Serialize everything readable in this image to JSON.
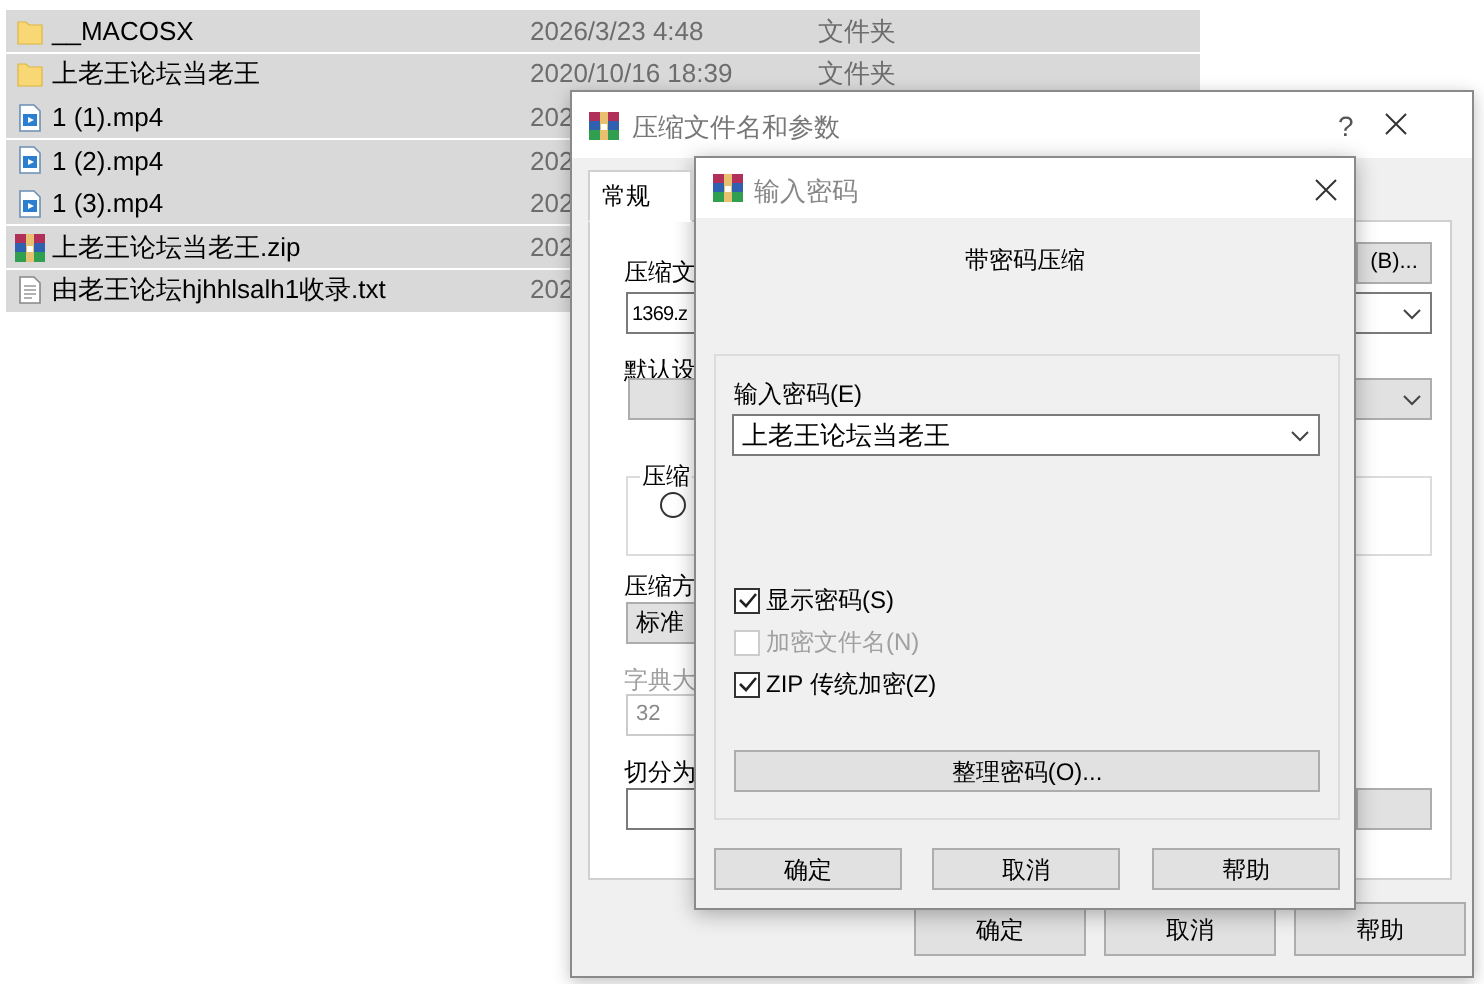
{
  "files": [
    {
      "name": "__MACOSX",
      "date": "2026/3/23 4:48",
      "type": "文件夹",
      "kind": "folder"
    },
    {
      "name": "上老王论坛当老王",
      "date": "2020/10/16 18:39",
      "type": "文件夹",
      "kind": "folder"
    },
    {
      "name": "1 (1).mp4",
      "date": "202",
      "kind": "video"
    },
    {
      "name": "1 (2).mp4",
      "date": "202",
      "kind": "video"
    },
    {
      "name": "1 (3).mp4",
      "date": "202",
      "kind": "video"
    },
    {
      "name": "上老王论坛当老王.zip",
      "date": "202",
      "kind": "archive"
    },
    {
      "name": "由老王论坛hjhhlsalh1收录.txt",
      "date": "202",
      "kind": "text"
    }
  ],
  "archive_dialog": {
    "title": "压缩文件名和参数",
    "help": "?",
    "tabs": [
      {
        "label": "常规",
        "selected": true
      }
    ],
    "archive_name_label": "压缩文",
    "archive_name": "1369.z",
    "browse_button": "(B)...",
    "profile_label": "默认设",
    "format_group": "压缩",
    "format_options": [
      {
        "selected": false
      }
    ],
    "method_label": "压缩方",
    "method": "标准",
    "dictionary_label": "字典大",
    "dictionary": "32",
    "split_label": "切分为",
    "buttons": [
      "确定",
      "取消",
      "帮助"
    ]
  },
  "password_dialog": {
    "title": "输入密码",
    "heading": "带密码压缩",
    "password_label": "输入密码(E)",
    "password": "上老王论坛当老王",
    "options": [
      {
        "label": "显示密码(S)",
        "checked": true,
        "disabled": false
      },
      {
        "label": "加密文件名(N)",
        "checked": false,
        "disabled": true
      },
      {
        "label": "ZIP 传统加密(Z)",
        "checked": true,
        "disabled": false
      }
    ],
    "manage_button": "整理密码(O)...",
    "buttons": [
      "确定",
      "取消",
      "帮助"
    ]
  }
}
